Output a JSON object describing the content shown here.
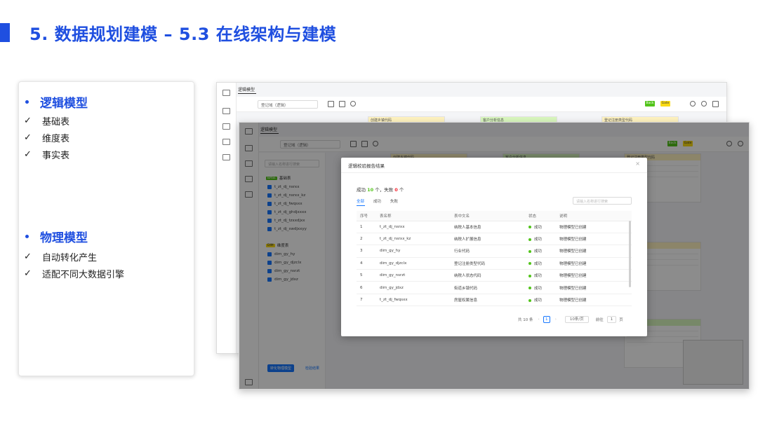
{
  "slide": {
    "title": "5. 数据规划建模 – 5.3 在线架构与建模"
  },
  "left_card": {
    "sections": [
      {
        "heading": "逻辑模型",
        "items": [
          "基础表",
          "维度表",
          "事实表"
        ]
      },
      {
        "heading": "物理模型",
        "items": [
          "自动转化产生",
          "适配不同大数据引擎"
        ]
      }
    ],
    "bullet_glyph": "•",
    "check_glyph": "✓"
  },
  "screenshot": {
    "tab_title": "逻辑模型",
    "layer_select": "登记域（逻辑）",
    "badges": [
      {
        "text": "Back",
        "color": "#52c41a"
      },
      {
        "text": "Gate",
        "color": "#fadb14"
      }
    ],
    "side_panel": {
      "search_placeholder": "请输入名称进行搜索",
      "groups": [
        {
          "tag": "BASE",
          "label": "基础表",
          "items": [
            "t_zt_dj_nsrxx",
            "t_zt_dj_nsrxx_kz",
            "t_zt_dj_fwqsxx",
            "t_zt_dj_ghdjxxxx",
            "t_zt_dj_tzxxdjxx",
            "t_zt_dj_swdjxxyy"
          ]
        },
        {
          "tag": "DIM",
          "label": "维度表",
          "items": [
            "dim_gy_hy",
            "dim_gy_djzclx",
            "dim_gy_nsrzt",
            "dim_gy_jdxz"
          ]
        }
      ],
      "primary_button": "转化物理模型",
      "link_button": "检验结果"
    },
    "canvas_cards": [
      "创建乡镇代码",
      "客户分析信息",
      "登记注册类型代码"
    ],
    "modal": {
      "title": "逻辑校验报告结果",
      "close": "×",
      "summary_prefix": "成功",
      "success_count": "10",
      "summary_mid": "个，失败",
      "fail_count": "0",
      "summary_suffix": "个",
      "tabs": [
        "全部",
        "成功",
        "失败"
      ],
      "search_placeholder": "请输入名称进行搜索",
      "columns": [
        "序号",
        "表名称",
        "表中文名",
        "状态",
        "说明"
      ],
      "rows": [
        {
          "no": "1",
          "name": "t_zt_dj_nsrxx",
          "cn": "纳税人基本信息",
          "status": "成功",
          "note": "物理模型已创建"
        },
        {
          "no": "2",
          "name": "t_zt_dj_nsrxx_kz",
          "cn": "纳税人扩展信息",
          "status": "成功",
          "note": "物理模型已创建"
        },
        {
          "no": "3",
          "name": "dim_gy_hy",
          "cn": "行业代码",
          "status": "成功",
          "note": "物理模型已创建"
        },
        {
          "no": "4",
          "name": "dim_gy_djzclx",
          "cn": "登记注册类型代码",
          "status": "成功",
          "note": "物理模型已创建"
        },
        {
          "no": "5",
          "name": "dim_gy_nsrzt",
          "cn": "纳税人状态代码",
          "status": "成功",
          "note": "物理模型已创建"
        },
        {
          "no": "6",
          "name": "dim_gy_jdxz",
          "cn": "街道乡镇代码",
          "status": "成功",
          "note": "物理模型已创建"
        },
        {
          "no": "7",
          "name": "t_zt_dj_fwqsxx",
          "cn": "房屋权属信息",
          "status": "成功",
          "note": "物理模型已创建"
        }
      ],
      "pager": {
        "total": "共 10 条",
        "current_page": "1",
        "page_size": "10条/页",
        "goto_label": "前往",
        "goto_value": "1",
        "goto_suffix": "页",
        "prev": "‹",
        "next": "›"
      }
    }
  }
}
